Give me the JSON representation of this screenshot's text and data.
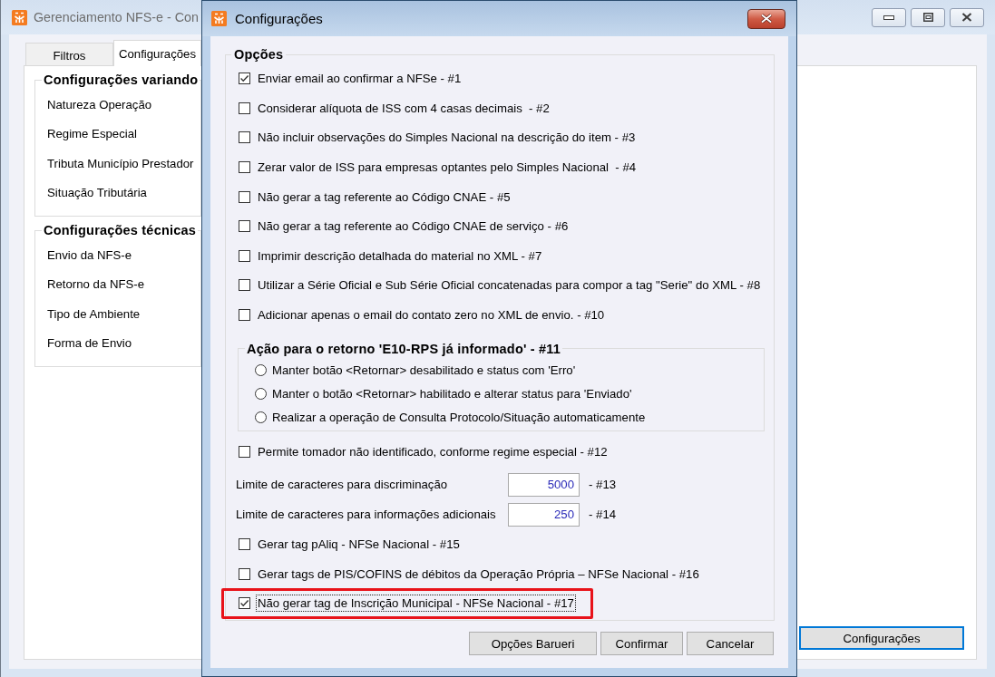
{
  "main_window": {
    "title": "Gerenciamento NFS-e - Con",
    "tabs": [
      {
        "label": "Filtros",
        "selected": false
      },
      {
        "label": "Configurações",
        "selected": true
      }
    ],
    "groups": [
      {
        "title": "Configurações variando",
        "items": [
          "Natureza Operação",
          "Regime Especial",
          "Tributa Município Prestador",
          "Situação Tributária"
        ]
      },
      {
        "title": "Configurações técnicas",
        "items": [
          "Envio da NFS-e",
          "Retorno da NFS-e",
          "Tipo de Ambiente",
          "Forma de Envio"
        ]
      }
    ],
    "button": {
      "label": "Configurações",
      "focused": true
    }
  },
  "dialog": {
    "title": "Configurações",
    "group": {
      "title": "Opções",
      "items": [
        {
          "kind": "checkbox",
          "label": "Enviar email ao confirmar a NFSe - #1",
          "checked": true,
          "focused": false,
          "highlighted": false
        },
        {
          "kind": "checkbox",
          "label": "Considerar alíquota de ISS com 4 casas decimais  - #2",
          "checked": false,
          "focused": false,
          "highlighted": false
        },
        {
          "kind": "checkbox",
          "label": "Não incluir observações do Simples Nacional na descrição do item - #3",
          "checked": false,
          "focused": false,
          "highlighted": false
        },
        {
          "kind": "checkbox",
          "label": "Zerar valor de ISS para empresas optantes pelo Simples Nacional  - #4",
          "checked": false,
          "focused": false,
          "highlighted": false
        },
        {
          "kind": "checkbox",
          "label": "Não gerar a tag referente ao Código CNAE - #5",
          "checked": false,
          "focused": false,
          "highlighted": false
        },
        {
          "kind": "checkbox",
          "label": "Não gerar a tag referente ao Código CNAE de serviço - #6",
          "checked": false,
          "focused": false,
          "highlighted": false
        },
        {
          "kind": "checkbox",
          "label": "Imprimir descrição detalhada do material no XML - #7",
          "checked": false,
          "focused": false,
          "highlighted": false
        },
        {
          "kind": "checkbox",
          "label": "Utilizar a Série Oficial e Sub Série Oficial concatenadas para compor a tag \"Serie\" do XML - #8",
          "checked": false,
          "focused": false,
          "highlighted": false
        },
        {
          "kind": "checkbox",
          "label": "Adicionar apenas o email do contato zero no XML de envio. - #10",
          "checked": false,
          "focused": false,
          "highlighted": false
        },
        {
          "kind": "radio_group",
          "title": "Ação para o retorno 'E10-RPS já informado' - #11",
          "options": [
            {
              "label": "Manter botão <Retornar> desabilitado e status com 'Erro'",
              "selected": false
            },
            {
              "label": "Manter o botão <Retornar> habilitado e alterar status para 'Enviado'",
              "selected": false
            },
            {
              "label": "Realizar a operação de Consulta Protocolo/Situação automaticamente",
              "selected": false
            }
          ]
        },
        {
          "kind": "checkbox",
          "label": "Permite tomador não identificado, conforme regime especial - #12",
          "checked": false,
          "focused": false,
          "highlighted": false
        },
        {
          "kind": "number",
          "label": "Limite de caracteres para discriminação",
          "value": "5000",
          "suffix": "- #13"
        },
        {
          "kind": "number",
          "label": "Limite de caracteres para informações adicionais",
          "value": "250",
          "suffix": "- #14"
        },
        {
          "kind": "checkbox",
          "label": "Gerar tag pAliq - NFSe Nacional - #15",
          "checked": false,
          "focused": false,
          "highlighted": false
        },
        {
          "kind": "checkbox",
          "label": "Gerar tags de PIS/COFINS de débitos da Operação Própria – NFSe Nacional - #16",
          "checked": false,
          "focused": false,
          "highlighted": false
        },
        {
          "kind": "checkbox",
          "label": "Não gerar tag de Inscrição Municipal - NFSe Nacional - #17",
          "checked": true,
          "focused": true,
          "highlighted": true
        }
      ]
    },
    "buttons": [
      "Opções Barueri",
      "Confirmar",
      "Cancelar"
    ]
  }
}
